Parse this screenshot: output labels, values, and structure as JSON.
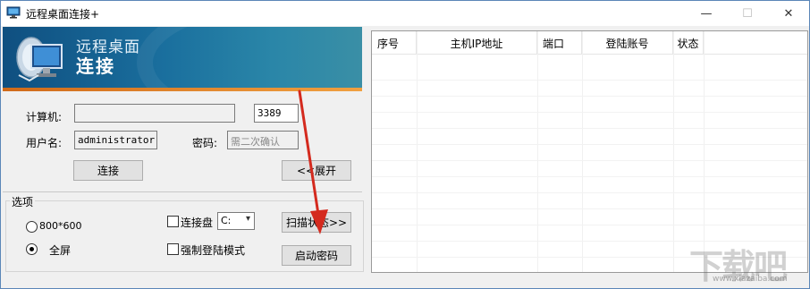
{
  "window": {
    "title": "远程桌面连接+",
    "controls": {
      "minimize": "—",
      "maximize": "☐",
      "close": "✕"
    }
  },
  "banner": {
    "line1": "远程桌面",
    "line2": "连接"
  },
  "form": {
    "computer_label": "计算机:",
    "computer_value": "",
    "port_value": "3389",
    "username_label": "用户名:",
    "username_value": "administrator",
    "password_label": "密码:",
    "password_placeholder": "需二次确认",
    "connect_button": "连接",
    "expand_button": "<<展开"
  },
  "options": {
    "group_label": "选项",
    "resolution_label": "800*600",
    "fullscreen_label": "全屏",
    "resolution_selected": false,
    "fullscreen_selected": true,
    "connect_drive_label": "连接盘",
    "connect_drive_checked": false,
    "drive_value": "C:",
    "force_login_label": "强制登陆模式",
    "force_login_checked": false,
    "scan_button": "扫描状态>>",
    "start_password_button": "启动密码"
  },
  "table": {
    "columns": [
      "序号",
      "主机IP地址",
      "端口",
      "登陆账号",
      "状态"
    ],
    "rows": []
  },
  "watermark": {
    "text": "下载吧",
    "url": "www.xiazaiba.com"
  },
  "colors": {
    "banner_dark": "#0f4f80",
    "banner_accent": "#f0a040",
    "annotation_arrow": "#d42a1e"
  }
}
